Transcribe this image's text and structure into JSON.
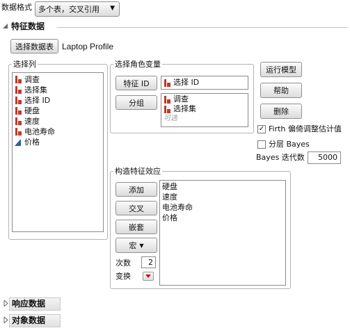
{
  "data_format": {
    "label": "数据格式",
    "selected": "多个表，交叉引用"
  },
  "section": {
    "title": "特征数据"
  },
  "select_table": {
    "button": "选择数据表",
    "table_name": "Laptop Profile"
  },
  "columns": {
    "title": "选择列",
    "items": [
      {
        "label": "调查",
        "icon": "nominal-bar-icon"
      },
      {
        "label": "选择集",
        "icon": "nominal-bar-icon"
      },
      {
        "label": "选择 ID",
        "icon": "nominal-bar-icon"
      },
      {
        "label": "硬盘",
        "icon": "nominal-bar-icon"
      },
      {
        "label": "速度",
        "icon": "nominal-bar-icon"
      },
      {
        "label": "电池寿命",
        "icon": "nominal-bar-icon"
      },
      {
        "label": "价格",
        "icon": "continuous-triangle-icon"
      }
    ]
  },
  "roles": {
    "title": "选择角色变量",
    "feature_id": {
      "button": "特征 ID",
      "value": "选择 ID"
    },
    "grouping": {
      "button": "分组",
      "values": [
        "调查",
        "选择集"
      ],
      "optional": "可选"
    }
  },
  "actions": {
    "run": "运行模型",
    "help": "帮助",
    "remove": "删除"
  },
  "options": {
    "firth": {
      "label": "Firth 偏倚调整估计值",
      "checked": true
    },
    "bayes": {
      "label": "分层 Bayes",
      "checked": false
    },
    "bayes_iter": {
      "label": "Bayes 迭代数",
      "value": "5000"
    }
  },
  "effects": {
    "title": "构造特征效应",
    "buttons": {
      "add": "添加",
      "cross": "交叉",
      "nest": "嵌套",
      "macro": "宏"
    },
    "degree_label": "次数",
    "degree_value": "2",
    "transform_label": "变换",
    "items": [
      "硬盘",
      "速度",
      "电池寿命",
      "价格"
    ]
  },
  "bottom_sections": {
    "response": "响应数据",
    "subject": "对象数据"
  },
  "colors": {
    "nominal": "#c0392b",
    "continuous": "#2f5aa8",
    "transform_arrow": "#cc1111"
  }
}
